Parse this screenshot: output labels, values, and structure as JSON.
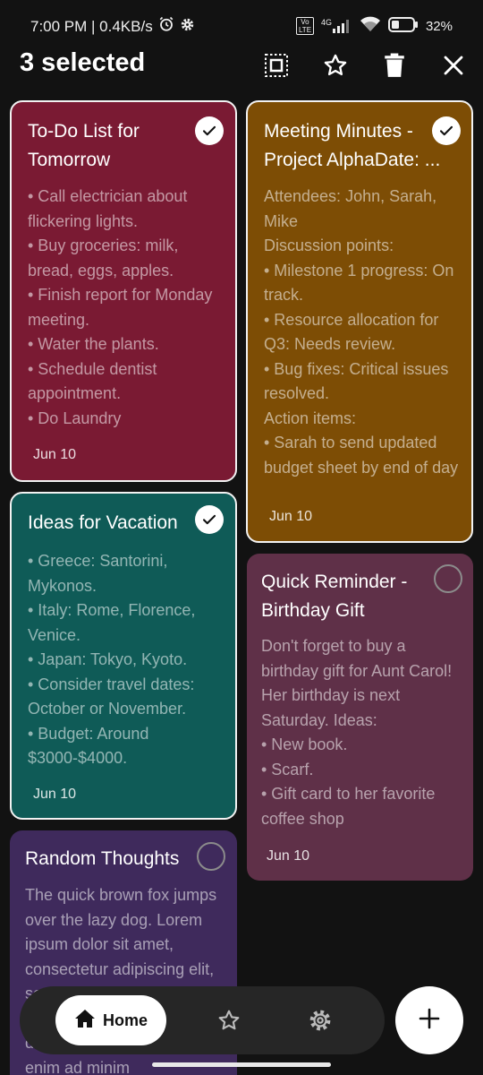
{
  "status": {
    "time_speed": "7:00 PM | 0.4KB/s",
    "network": "4G",
    "volte": "Vo LTE",
    "battery": "32%"
  },
  "header": {
    "selected_count": "3 selected"
  },
  "notes": [
    {
      "title": "To-Do List for Tomorrow",
      "body": "• Call electrician about flickering lights.\n • Buy groceries: milk, bread, eggs, apples.\n • Finish report for Monday meeting.\n • Water the plants.\n • Schedule dentist appointment.\n • Do Laundry",
      "date": "Jun 10",
      "selected": true,
      "color": "#7a1a33"
    },
    {
      "title": "Meeting Minutes - Project AlphaDate: ...",
      "body": "Attendees: John, Sarah, Mike\nDiscussion points:\n • Milestone 1 progress: On track.\n • Resource allocation for Q3: Needs review.\n • Bug fixes: Critical issues resolved.\n    Action items:\n • Sarah to send updated budget sheet by end of day",
      "date": "Jun 10",
      "selected": true,
      "color": "#7d4d05"
    },
    {
      "title": "Ideas for Vacation",
      "body": "• Greece: Santorini, Mykonos.\n • Italy: Rome, Florence, Venice.\n • Japan: Tokyo, Kyoto.\n • Consider travel dates: October or November.\n • Budget: Around $3000-$4000.",
      "date": "Jun 10",
      "selected": true,
      "color": "#0f5b57"
    },
    {
      "title": "Quick Reminder - Birthday Gift",
      "body": "Don't forget to buy a birthday gift for Aunt Carol! Her birthday is next Saturday. Ideas:\n • New book.\n • Scarf.\n • Gift card to her favorite coffee shop",
      "date": "Jun 10",
      "selected": false,
      "color": "#5f3048"
    },
    {
      "title": "Random Thoughts",
      "body": "The quick brown fox jumps over the lazy dog. Lorem ipsum dolor sit amet, consectetur adipiscing elit, sed do eiusmod tempor incididunt ut labore et dolore magna aliqua. Ut enim ad minim",
      "date": "",
      "selected": false,
      "color": "#3f2a5c"
    }
  ],
  "nav": {
    "home_label": "Home"
  },
  "icons": [
    "alarm-icon",
    "gear-icon",
    "signal-icon",
    "wifi-icon",
    "battery-icon",
    "select-all-icon",
    "star-icon",
    "trash-icon",
    "close-icon",
    "check-icon",
    "home-icon",
    "settings-icon",
    "plus-icon"
  ]
}
